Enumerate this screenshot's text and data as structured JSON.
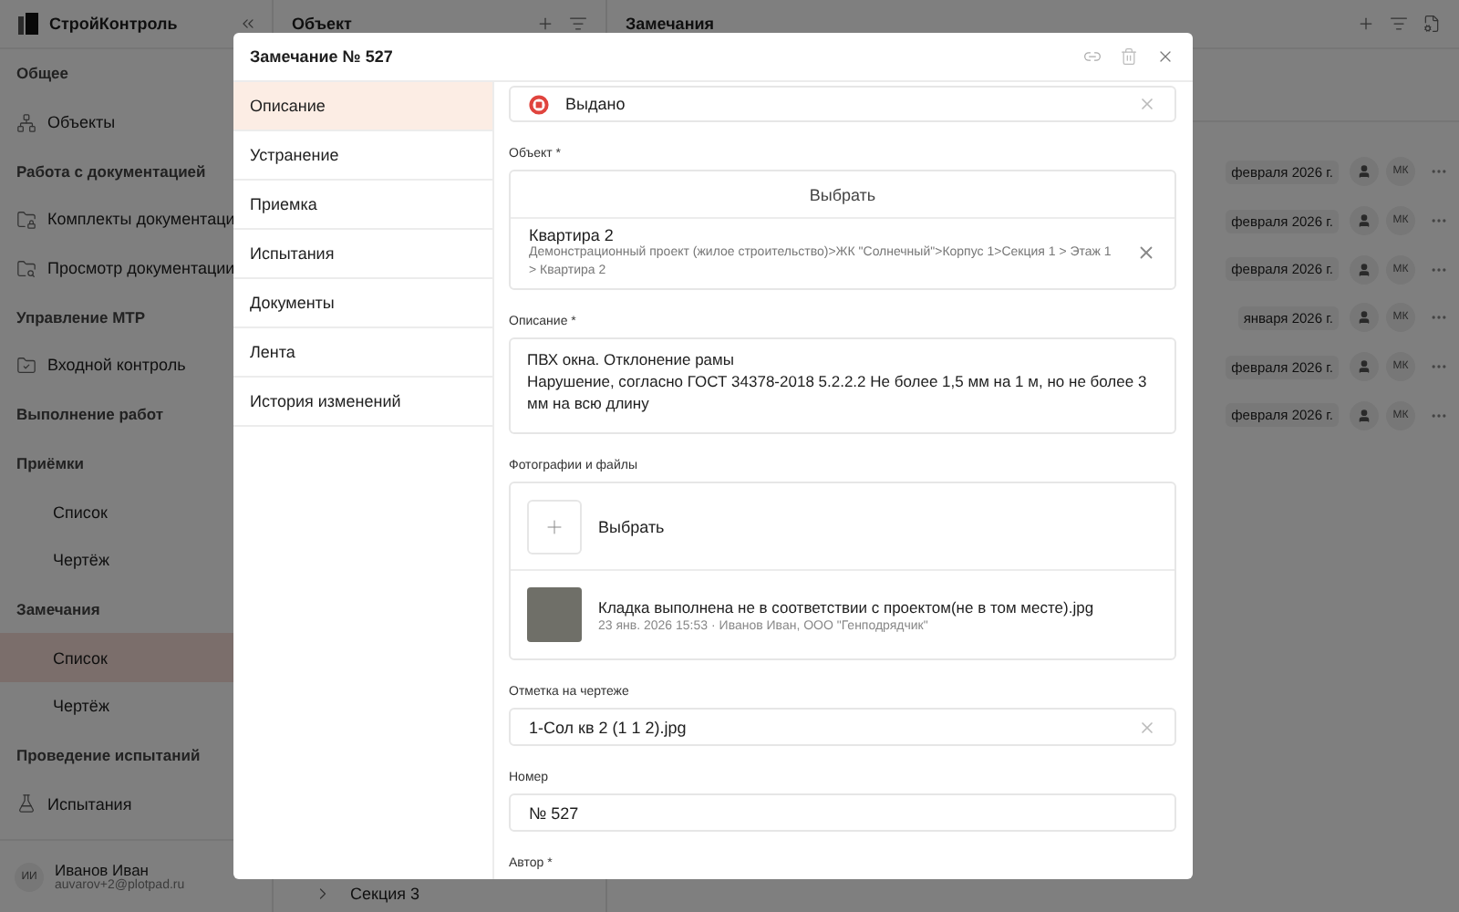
{
  "app": {
    "name": "СтройКонтроль"
  },
  "sidebar": {
    "groups": [
      {
        "title": "Общее",
        "items": [
          {
            "label": "Объекты",
            "kind": "icon",
            "selected": false
          }
        ]
      },
      {
        "title": "Работа с документацией",
        "items": [
          {
            "label": "Комплекты документаци",
            "kind": "icon",
            "selected": false
          },
          {
            "label": "Просмотр документации",
            "kind": "icon",
            "selected": false
          }
        ]
      },
      {
        "title": "Управление МТР",
        "items": [
          {
            "label": "Входной контроль",
            "kind": "icon",
            "selected": false
          }
        ]
      },
      {
        "title": "Выполнение работ"
      },
      {
        "title": "Приёмки",
        "items": [
          {
            "label": "Список",
            "kind": "sub",
            "selected": false
          },
          {
            "label": "Чертёж",
            "kind": "sub",
            "selected": false
          }
        ]
      },
      {
        "title": "Замечания",
        "items": [
          {
            "label": "Список",
            "kind": "sub",
            "selected": true
          },
          {
            "label": "Чертёж",
            "kind": "sub",
            "selected": false
          }
        ]
      },
      {
        "title": "Проведение испытаний",
        "items": [
          {
            "label": "Испытания",
            "kind": "icon",
            "selected": false
          }
        ]
      }
    ]
  },
  "user": {
    "initials": "ИИ",
    "name": "Иванов Иван",
    "email": "auvarov+2@plotpad.ru"
  },
  "object_panel": {
    "title": "Объект",
    "tree_item": "Секция 3"
  },
  "remarks_panel": {
    "title": "Замечания",
    "rows": [
      {
        "date": "февраля 2026 г.",
        "avatar": "МК"
      },
      {
        "date": "февраля 2026 г.",
        "avatar": "МК"
      },
      {
        "date": "февраля 2026 г.",
        "avatar": "МК"
      },
      {
        "date": "января 2026 г.",
        "avatar": "МК"
      },
      {
        "date": "февраля 2026 г.",
        "avatar": "МК"
      },
      {
        "date": "февраля 2026 г.",
        "avatar": "МК"
      }
    ]
  },
  "modal": {
    "title": "Замечание № 527",
    "tabs": [
      {
        "label": "Описание",
        "selected": true
      },
      {
        "label": "Устранение",
        "selected": false
      },
      {
        "label": "Приемка",
        "selected": false
      },
      {
        "label": "Испытания",
        "selected": false
      },
      {
        "label": "Документы",
        "selected": false
      },
      {
        "label": "Лента",
        "selected": false
      },
      {
        "label": "История изменений",
        "selected": false
      }
    ],
    "status": {
      "label": "Выдано"
    },
    "object": {
      "label": "Объект *",
      "select": "Выбрать",
      "item": "Квартира 2",
      "path": "Демонстрационный проект (жилое строительство)>ЖК \"Солнечный\">Корпус 1>Секция 1 > Этаж 1 > Квартира 2"
    },
    "description": {
      "label": "Описание *",
      "value": "ПВХ окна. Отклонение рамы\nНарушение, согласно ГОСТ 34378-2018 5.2.2.2 Не более 1,5 мм на 1 м, но не более 3 мм на всю длину"
    },
    "files": {
      "label": "Фотографии и файлы",
      "add": "Выбрать",
      "items": [
        {
          "name": "Кладка выполнена не в соответствии с проектом(не в том месте).jpg",
          "date": "23 янв. 2026 15:53",
          "separator": "·",
          "author": "Иванов Иван, ООО \"Генподрядчик\""
        }
      ]
    },
    "drawing": {
      "label": "Отметка на чертеже",
      "value": "1-Сол кв 2 (1 1 2).jpg"
    },
    "number": {
      "label": "Номер",
      "value": "№ 527"
    },
    "author": {
      "label": "Автор *"
    }
  }
}
